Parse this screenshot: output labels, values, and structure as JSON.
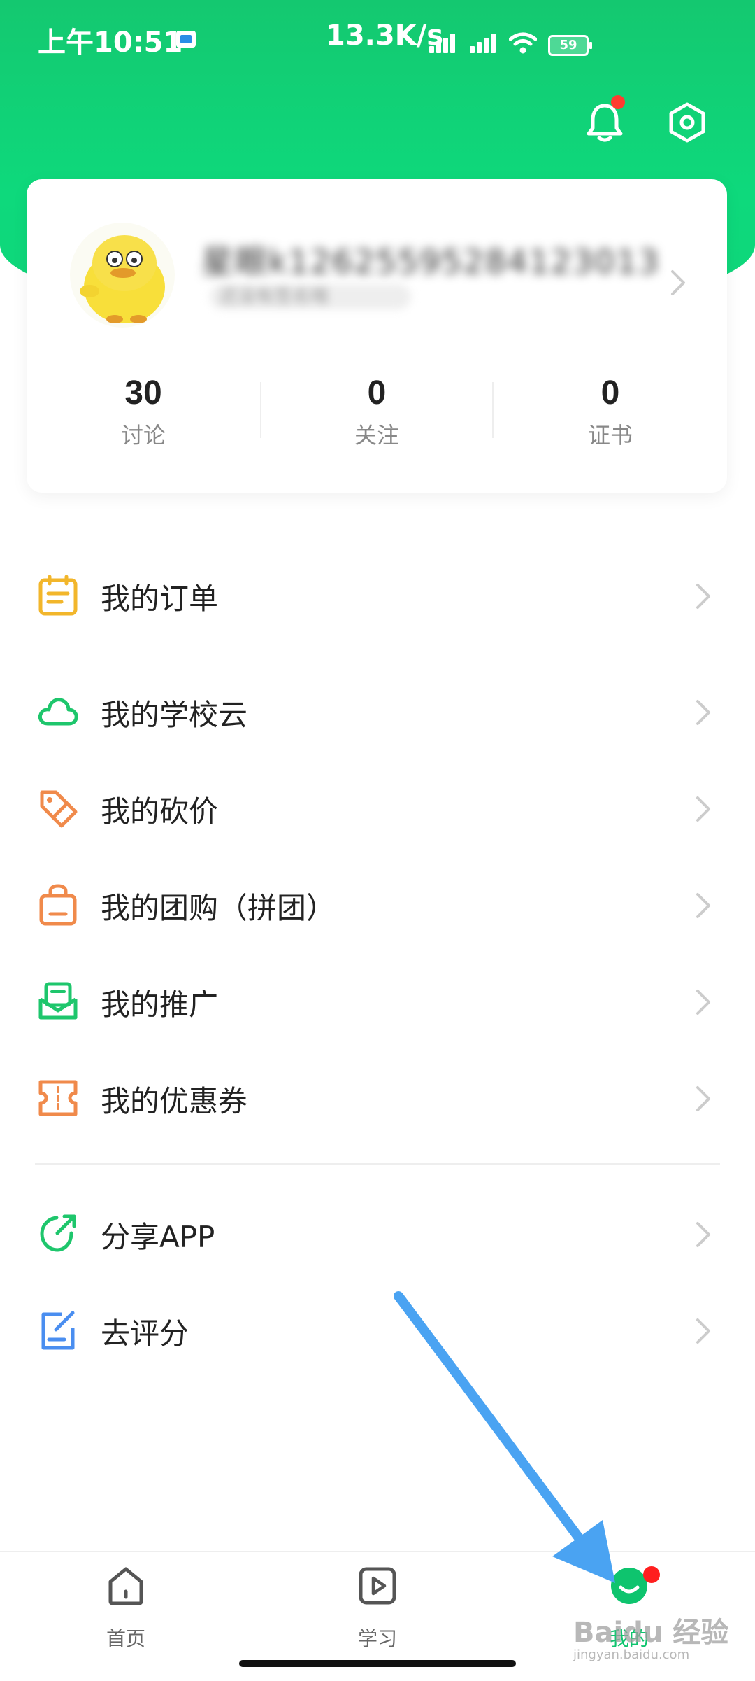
{
  "status_bar": {
    "time": "上午10:51",
    "network_speed": "13.3K/s",
    "battery": "59"
  },
  "profile": {
    "username": "星眼k12625595284123013",
    "subtitle": "还没有签名哦",
    "stats": [
      {
        "value": "30",
        "label": "讨论"
      },
      {
        "value": "0",
        "label": "关注"
      },
      {
        "value": "0",
        "label": "证书"
      }
    ]
  },
  "menu": {
    "orders": "我的订单",
    "school_cloud": "我的学校云",
    "bargain": "我的砍价",
    "group_buy": "我的团购（拼团）",
    "promotion": "我的推广",
    "coupons": "我的优惠券",
    "share_app": "分享APP",
    "rate": "去评分"
  },
  "tabbar": {
    "home": "首页",
    "learn": "学习",
    "mine": "我的"
  },
  "watermark": {
    "brand": "Baidu 经验",
    "url": "jingyan.baidu.com"
  },
  "colors": {
    "brand_green": "#0ed97c",
    "active_tab": "#0ec46e",
    "badge_red": "#ff3b30",
    "annotation_arrow": "#4aa3f2"
  },
  "icons": {
    "notification": "bell-icon",
    "settings": "hexagon-gear-icon",
    "orders": "clipboard-icon",
    "school_cloud": "cloud-icon",
    "bargain": "tag-discount-icon",
    "group_buy": "shopping-bag-icon",
    "promotion": "envelope-icon",
    "coupons": "ticket-icon",
    "share_app": "share-arrow-icon",
    "rate": "edit-note-icon"
  }
}
